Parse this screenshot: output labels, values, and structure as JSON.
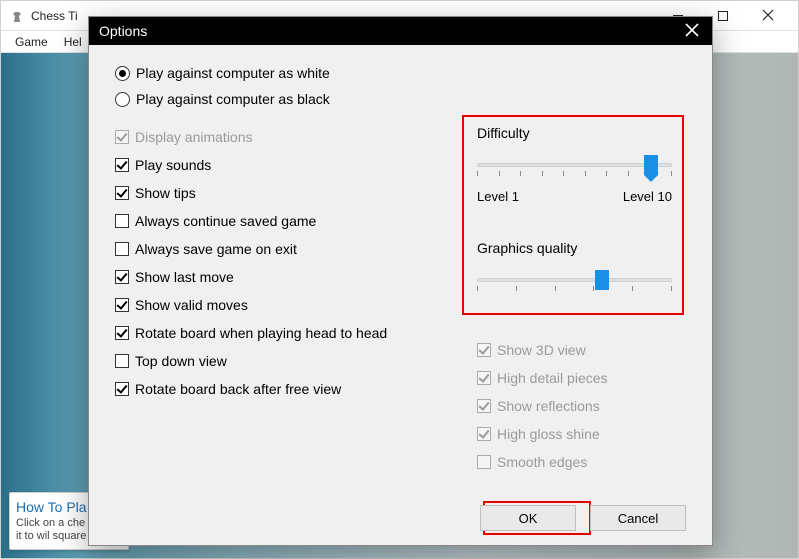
{
  "app": {
    "title": "Chess Ti",
    "menubar": [
      "Game",
      "Hel"
    ]
  },
  "tooltip": {
    "title": "How To Pla",
    "body": "Click on a che\nmove it to wil\nsquare to mo"
  },
  "modal": {
    "title": "Options",
    "radios": {
      "white": "Play against computer as white",
      "black": "Play against computer as black",
      "selected": "white"
    },
    "checkboxes_left": [
      {
        "label": "Display animations",
        "checked": true,
        "disabled": true
      },
      {
        "label": "Play sounds",
        "checked": true,
        "disabled": false
      },
      {
        "label": "Show tips",
        "checked": true,
        "disabled": false
      },
      {
        "label": "Always continue saved game",
        "checked": false,
        "disabled": false
      },
      {
        "label": "Always save game on exit",
        "checked": false,
        "disabled": false
      },
      {
        "label": "Show last move",
        "checked": true,
        "disabled": false
      },
      {
        "label": "Show valid moves",
        "checked": true,
        "disabled": false
      },
      {
        "label": "Rotate board when playing head to head",
        "checked": true,
        "disabled": false
      },
      {
        "label": "Top down view",
        "checked": false,
        "disabled": false
      },
      {
        "label": "Rotate board back after free view",
        "checked": true,
        "disabled": false
      }
    ],
    "difficulty": {
      "label": "Difficulty",
      "min_label": "Level 1",
      "max_label": "Level 10",
      "value_percent": 89,
      "ticks": 10
    },
    "graphics": {
      "label": "Graphics quality",
      "value_percent": 64,
      "ticks": 6
    },
    "checkboxes_right": [
      {
        "label": "Show 3D view",
        "checked": true,
        "disabled": true
      },
      {
        "label": "High detail pieces",
        "checked": true,
        "disabled": true
      },
      {
        "label": "Show reflections",
        "checked": true,
        "disabled": true
      },
      {
        "label": "High gloss shine",
        "checked": true,
        "disabled": true
      },
      {
        "label": "Smooth edges",
        "checked": false,
        "disabled": true
      }
    ],
    "buttons": {
      "ok": "OK",
      "cancel": "Cancel"
    },
    "highlight_color": "#e80000"
  }
}
